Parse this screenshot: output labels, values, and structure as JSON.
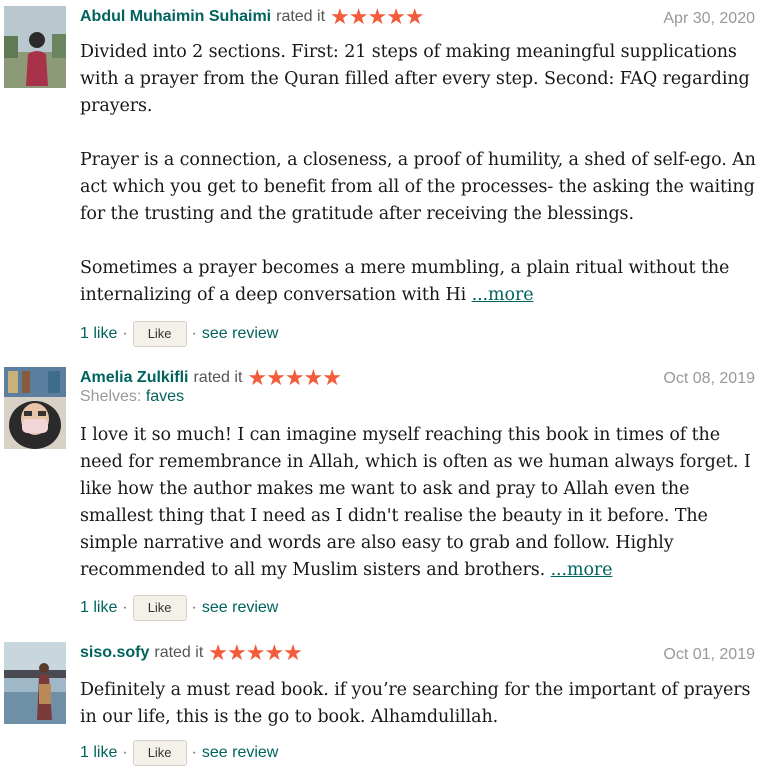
{
  "reviews": [
    {
      "user": "Abdul Muhaimin Suhaimi",
      "rated_text": "rated it",
      "stars": "★★★★★",
      "date": "Apr 30, 2020",
      "paragraphs": [
        "Divided into 2 sections. First: 21 steps of making meaningful supplications with a prayer from the Quran filled after every step. Second: FAQ regarding prayers.",
        "Prayer is a connection, a closeness, a proof of humility, a shed of self-ego. An act which you get to benefit from all of the processes- the asking the waiting for the trusting and the gratitude after receiving the blessings.",
        "Sometimes a prayer becomes a mere mumbling, a plain ritual without the internalizing of a deep conversation with Hi"
      ],
      "more": "...more",
      "likes": "1 like",
      "like_button": "Like",
      "see_review": "see review"
    },
    {
      "user": "Amelia Zulkifli",
      "rated_text": "rated it",
      "stars": "★★★★★",
      "date": "Oct 08, 2019",
      "shelves_label": "Shelves:",
      "shelf": "faves",
      "paragraphs": [
        "I love it so much! I can imagine myself reaching this book in times of the need for remembrance in Allah, which is often as we human always forget. I like how the author makes me want to ask and pray to Allah even the smallest thing that I need as I didn't realise the beauty in it before. The simple narrative and words are also easy to grab and follow. Highly recommended to all my Muslim sisters and brothers."
      ],
      "more": "...more",
      "likes": "1 like",
      "like_button": "Like",
      "see_review": "see review"
    },
    {
      "user": "siso.sofy",
      "rated_text": "rated it",
      "stars": "★★★★★",
      "date": "Oct 01, 2019",
      "paragraphs": [
        "Definitely a must read book. if you’re searching for the important of prayers in our life, this is the go to book. Alhamdulillah."
      ],
      "likes": "1 like",
      "like_button": "Like",
      "see_review": "see review"
    }
  ],
  "separator": "·"
}
